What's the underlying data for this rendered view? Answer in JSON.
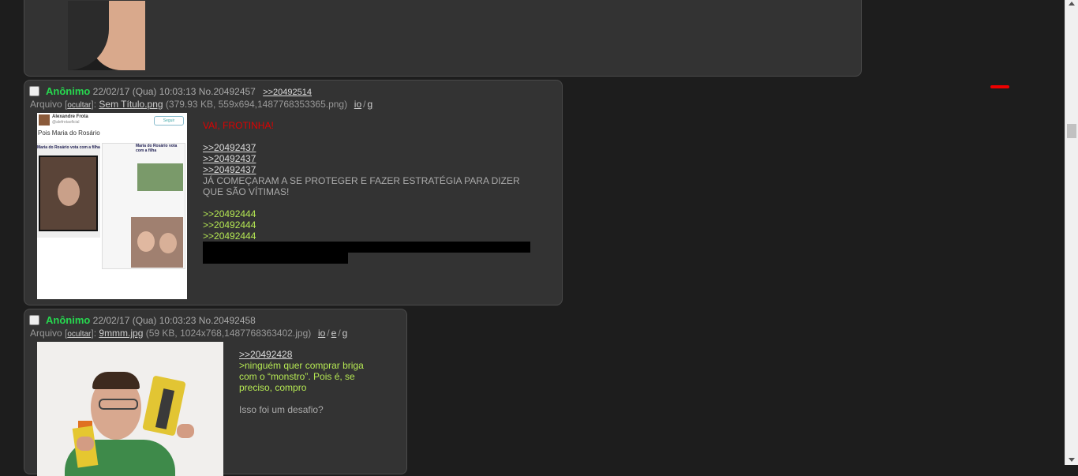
{
  "posts": [
    {
      "id": "post-1",
      "name": "Anônimo",
      "datetime": "22/02/17 (Qua) 10:03:13",
      "number": "No.20492457",
      "backlinks": [
        ">>20492514"
      ],
      "file_label": "Arquivo",
      "hide_label": "ocultar",
      "file_name": "Sem Título.png",
      "file_meta": "(379.93 KB, 559x694,1487768353365.png)",
      "nav": [
        "io",
        "g"
      ],
      "thumbnail": {
        "account_name": "Alexandre Frota",
        "account_handle": "@alefrotaoficial",
        "follow_button": "Seguir",
        "tweet_text": "Pois Maria do Rosário",
        "quoted_title": "Maria do Rosário vota com a filha"
      },
      "message": {
        "red": "VAI, FROTINHA!",
        "quotes_a": [
          ">>20492437",
          ">>20492437",
          ">>20492437"
        ],
        "text": "JÁ COMEÇARAM A SE PROTEGER E FAZER ESTRATÉGIA PARA DIZER QUE SÃO VÍTIMAS!",
        "greentext": [
          ">>20492444",
          ">>20492444",
          ">>20492444"
        ]
      }
    },
    {
      "id": "post-2",
      "name": "Anônimo",
      "datetime": "22/02/17 (Qua) 10:03:23",
      "number": "No.20492458",
      "file_label": "Arquivo",
      "hide_label": "ocultar",
      "file_name": "9mmm.jpg",
      "file_meta": "(59 KB, 1024x768,1487768363402.jpg)",
      "nav": [
        "io",
        "e",
        "g"
      ],
      "message": {
        "quote": ">>20492428",
        "greentext": ">ninguém quer comprar briga com o “monstro”. Pois é, se preciso, compro",
        "text": "Isso foi um desafio?"
      }
    }
  ],
  "colors": {
    "background": "#1d1d1d",
    "post_bg": "#333333",
    "name": "#27d84f",
    "greentext": "#b5e853",
    "redtext": "#e00000"
  }
}
